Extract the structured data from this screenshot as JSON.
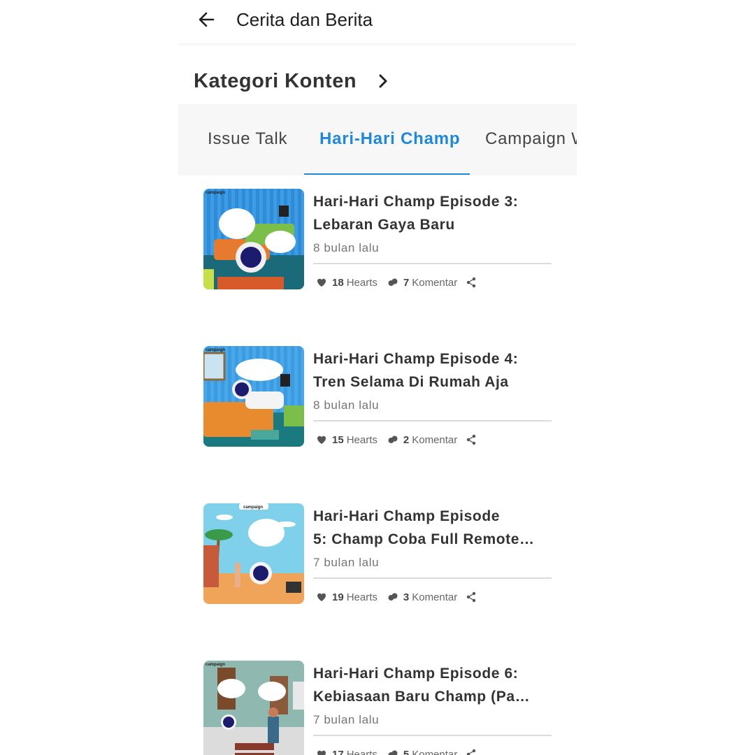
{
  "header": {
    "title": "Cerita dan Berita",
    "back_icon": "arrow-left-icon"
  },
  "category": {
    "title": "Kategori Konten",
    "chevron_icon": "chevron-right-icon"
  },
  "tabs": [
    {
      "label": "Issue Talk",
      "active": false
    },
    {
      "label": "Hari-Hari Champ",
      "active": true
    },
    {
      "label": "Campaign W",
      "active": false
    }
  ],
  "colors": {
    "accent": "#1f88d8",
    "text": "#333333",
    "muted": "#757575",
    "tabbar_bg": "#f7f7f7"
  },
  "posts": [
    {
      "title_line1": "Hari-Hari Champ Episode 3:",
      "title_line2": "Lebaran Gaya Baru",
      "ago": "8 bulan lalu",
      "hearts": "18",
      "hearts_label": "Hearts",
      "comments": "7",
      "comments_label": "Komentar",
      "thumb_brand": "campaign"
    },
    {
      "title_line1": "Hari-Hari Champ Episode 4:",
      "title_line2": "Tren Selama Di Rumah Aja",
      "ago": "8 bulan lalu",
      "hearts": "15",
      "hearts_label": "Hearts",
      "comments": "2",
      "comments_label": "Komentar",
      "thumb_brand": "campaign"
    },
    {
      "title_line1": "Hari-Hari Champ Episode",
      "title_line2": "5: Champ Coba Full Remote…",
      "ago": "7 bulan lalu",
      "hearts": "19",
      "hearts_label": "Hearts",
      "comments": "3",
      "comments_label": "Komentar",
      "thumb_brand": "campaign"
    },
    {
      "title_line1": "Hari-Hari Champ Episode 6:",
      "title_line2": "Kebiasaan Baru Champ (Pa…",
      "ago": "7 bulan lalu",
      "hearts": "17",
      "hearts_label": "Hearts",
      "comments": "5",
      "comments_label": "Komentar",
      "thumb_brand": "campaign"
    }
  ]
}
